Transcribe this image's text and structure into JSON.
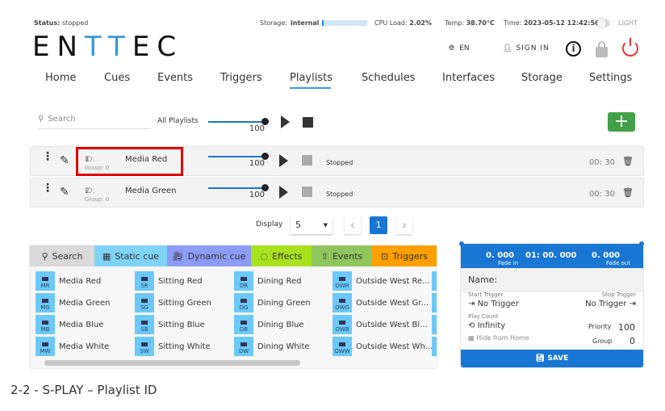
{
  "status": {
    "status_label": "Status:",
    "status": "stopped",
    "storage_label": "Storage:",
    "storage": "internal",
    "storage_fill_pct": 3,
    "cpu_label": "CPU Load:",
    "cpu": "2.02%",
    "temp_label": "Temp:",
    "temp": "38.70°C",
    "time_label": "Time:",
    "time": "2023-05-12 12:42:56",
    "theme": "LIGHT"
  },
  "header": {
    "logo": "ENTTEC",
    "lang": "EN",
    "sign_in": "SIGN IN"
  },
  "nav": [
    "Home",
    "Cues",
    "Events",
    "Triggers",
    "Playlists",
    "Schedules",
    "Interfaces",
    "Storage",
    "Settings"
  ],
  "nav_active": "Playlists",
  "toolbar": {
    "search_placeholder": "Search",
    "all_label": "All Playlists",
    "all_level": "100",
    "add": "+"
  },
  "playlists": [
    {
      "id_label": "ID:",
      "id": "1",
      "group_label": "Group:",
      "group": "0",
      "name": "Media Red",
      "level": "100",
      "state": "Stopped",
      "duration": "00: 30",
      "highlighted": true
    },
    {
      "id_label": "ID:",
      "id": "2",
      "group_label": "Group:",
      "group": "0",
      "name": "Media Green",
      "level": "100",
      "state": "Stopped",
      "duration": "00: 30",
      "highlighted": false
    }
  ],
  "pagination": {
    "display_label": "Display",
    "page_size": "5",
    "page": "1",
    "prev": "‹",
    "next": "›"
  },
  "palette": {
    "tabs": [
      {
        "label": "Search",
        "color": "#d9d9d9",
        "icon": "search-icon"
      },
      {
        "label": "Static cue",
        "color": "#7fd3f7",
        "icon": "static-cue-icon"
      },
      {
        "label": "Dynamic cue",
        "color": "#8c9cf5",
        "icon": "dynamic-cue-icon"
      },
      {
        "label": "Effects",
        "color": "#a8e21f",
        "icon": "palette-icon"
      },
      {
        "label": "Events",
        "color": "#8fc65d",
        "icon": "share-icon"
      },
      {
        "label": "Triggers",
        "color": "#ffa000",
        "icon": "trigger-icon"
      }
    ],
    "cues": [
      [
        {
          "abbr": "MR",
          "name": "Media Red"
        },
        {
          "abbr": "MG",
          "name": "Media Green"
        },
        {
          "abbr": "MB",
          "name": "Media Blue"
        },
        {
          "abbr": "MW",
          "name": "Media White"
        }
      ],
      [
        {
          "abbr": "SR",
          "name": "Sitting Red"
        },
        {
          "abbr": "SG",
          "name": "Sitting Green"
        },
        {
          "abbr": "SB",
          "name": "Sitting Blue"
        },
        {
          "abbr": "SW",
          "name": "Sitting White"
        }
      ],
      [
        {
          "abbr": "DR",
          "name": "Dining Red"
        },
        {
          "abbr": "DG",
          "name": "Dining Green"
        },
        {
          "abbr": "DB",
          "name": "Dining Blue"
        },
        {
          "abbr": "DW",
          "name": "Dining White"
        }
      ],
      [
        {
          "abbr": "OWR",
          "name": "Outside West Re..."
        },
        {
          "abbr": "OWG",
          "name": "Outside West Gr..."
        },
        {
          "abbr": "OWB",
          "name": "Outside West Bl..."
        },
        {
          "abbr": "OWW",
          "name": "Outside West Wh..."
        }
      ]
    ]
  },
  "editor": {
    "fade_in": "0. 000",
    "fade_in_label": "Fade in",
    "duration": "01: 00. 000",
    "fade_out": "0. 000",
    "fade_out_label": "Fade out",
    "name_label": "Name:",
    "start_trigger_label": "Start Trigger",
    "start_trigger": "No Trigger",
    "stop_trigger_label": "Stop Trigger",
    "stop_trigger": "No Trigger",
    "play_count_label": "Play Count",
    "play_count": "Infinity",
    "hide_label": "Hide from Home",
    "priority_label": "Priority",
    "priority": "100",
    "group_label": "Group",
    "group": "0",
    "save": "SAVE"
  },
  "caption": "2-2 - S-PLAY – Playlist ID",
  "colors": {
    "accent": "#1976d2",
    "logo_accent": "#3a9ad9",
    "add": "#43a047",
    "power": "#e53935",
    "highlight": "#e00000"
  }
}
